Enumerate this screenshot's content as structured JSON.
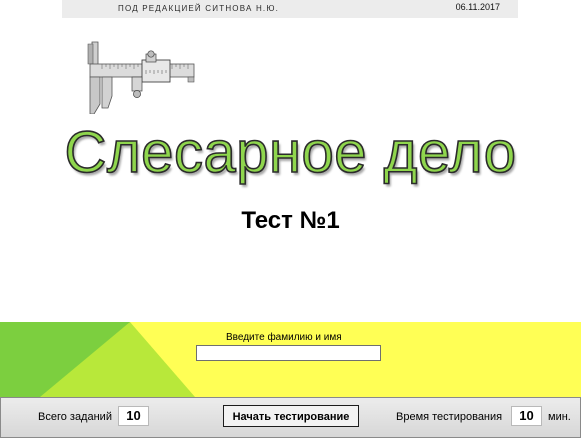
{
  "header": {
    "editor": "ПОД РЕДАКЦИЕЙ СИТНОВА Н.Ю.",
    "date": "06.11.2017"
  },
  "title": "Слесарное дело",
  "subtitle": "Тест №1",
  "illustration": {
    "icon": "caliper-icon"
  },
  "name_form": {
    "label": "Введите фамилию  и имя",
    "value": "",
    "placeholder": ""
  },
  "footer": {
    "total_tasks_label": "Всего заданий",
    "total_tasks_value": "10",
    "start_button": "Начать  тестирование",
    "time_label": "Время тестирования",
    "time_value": "10",
    "time_unit": "мин."
  },
  "colors": {
    "title_fill": "#8fd64d",
    "band_yellow": "#ffff55",
    "band_green": "#7ccf3f",
    "band_lightgreen": "#b8e83a"
  }
}
